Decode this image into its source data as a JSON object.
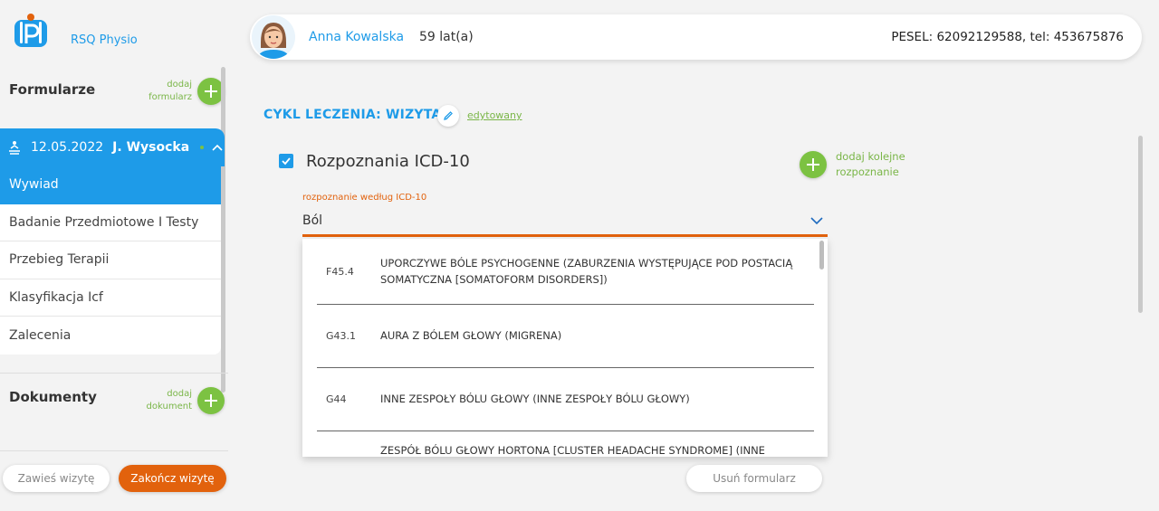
{
  "app": {
    "name": "RSQ Physio"
  },
  "sidebar": {
    "forms_title": "Formularze",
    "add_form_label": "dodaj formularz",
    "visit": {
      "date": "12.05.2022",
      "doctor": "J. Wysocka"
    },
    "items": [
      {
        "label": "Wywiad",
        "active": true
      },
      {
        "label": "Badanie Przedmiotowe I Testy",
        "active": false
      },
      {
        "label": "Przebieg Terapii",
        "active": false
      },
      {
        "label": "Klasyfikacja Icf",
        "active": false
      },
      {
        "label": "Zalecenia",
        "active": false
      }
    ],
    "documents_title": "Dokumenty",
    "add_document_label": "dodaj dokument",
    "suspend_label": "Zawieś wizytę",
    "finish_label": "Zakończ wizytę"
  },
  "patient": {
    "name": "Anna Kowalska",
    "age": "59 lat(a)",
    "ids": "PESEL: 62092129588, tel: 453675876"
  },
  "main": {
    "cycle_title": "CYKL LECZENIA: WIZYTA",
    "edited_label": "edytowany",
    "section_title": "Rozpoznania ICD-10",
    "add_diagnosis_label": "dodaj kolejne rozpoznanie",
    "field_label": "rozpoznanie według ICD-10",
    "field_value": "Ból",
    "options": [
      {
        "code": "F45.4",
        "text": "UPORCZYWE BÓLE PSYCHOGENNE (ZABURZENIA WYSTĘPUJĄCE POD POSTACIĄ SOMATYCZNA [SOMATOFORM DISORDERS])"
      },
      {
        "code": "G43.1",
        "text": "AURA Z BÓLEM GŁOWY (MIGRENA)"
      },
      {
        "code": "G44",
        "text": "INNE ZESPOŁY BÓLU GŁOWY (INNE ZESPOŁY BÓLU GŁOWY)"
      },
      {
        "code": "",
        "text": "ZESPÓŁ BÓLU GŁOWY HORTONA [CLUSTER HEADACHE SYNDROME] (INNE"
      }
    ],
    "remove_form_label": "Usuń formularz"
  },
  "colors": {
    "primary": "#1e9be8",
    "accent": "#e2620d",
    "add_green": "#7cc242"
  }
}
